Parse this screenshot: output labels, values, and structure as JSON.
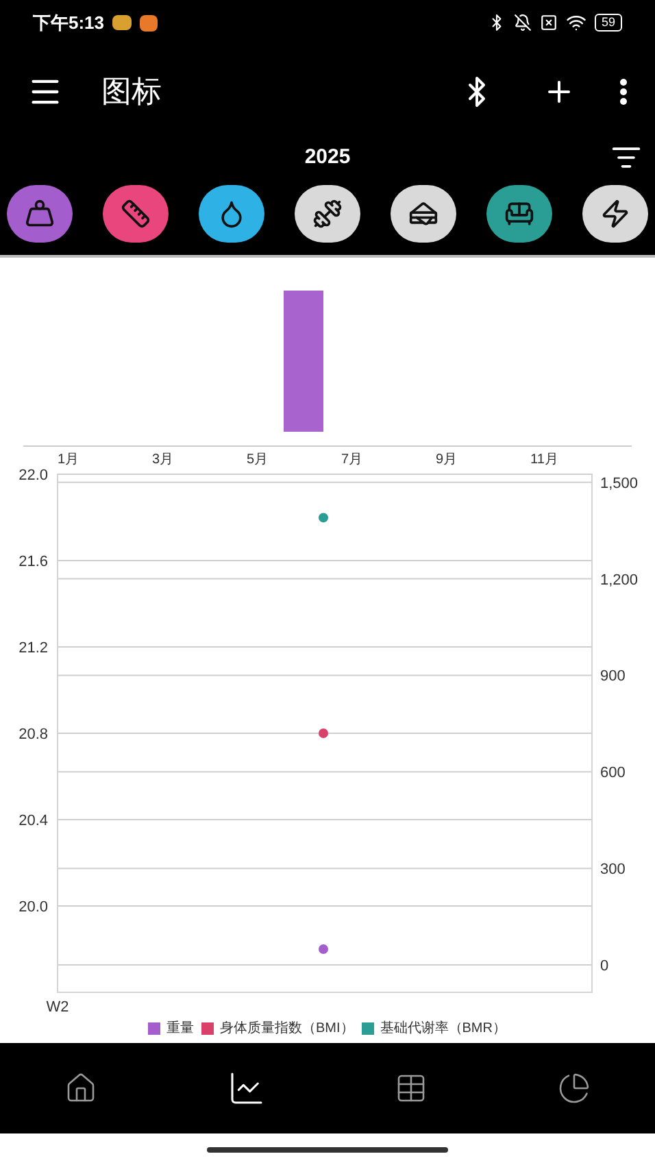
{
  "status_bar": {
    "time": "下午5:13",
    "battery": "59"
  },
  "app_bar": {
    "title": "图标"
  },
  "year_row": {
    "year": "2025"
  },
  "metric_icons": [
    {
      "kind": "weight",
      "color": "#a35dcc"
    },
    {
      "kind": "tape",
      "color": "#e8467c"
    },
    {
      "kind": "drop",
      "color": "#2eb2e5"
    },
    {
      "kind": "dumbbell",
      "color": "#d9d9d9"
    },
    {
      "kind": "burger",
      "color": "#d9d9d9"
    },
    {
      "kind": "sofa",
      "color": "#2a9d94"
    },
    {
      "kind": "energy",
      "color": "#d9d9d9"
    }
  ],
  "monthly_chart": {
    "month_labels": [
      "1月",
      "3月",
      "5月",
      "7月",
      "9月",
      "11月"
    ]
  },
  "trend_chart": {
    "period_label": "W2",
    "chart_data": {
      "type": "scatter",
      "series": [
        {
          "name": "重量",
          "color": "#a35dcc",
          "values": [
            19.8
          ]
        },
        {
          "name": "身体质量指数（BMI）",
          "color": "#d9416b",
          "values": [
            20.8
          ]
        }
      ],
      "grid": true,
      "ylim": [
        19.6,
        22.0
      ],
      "yticks": [
        {
          "value": 20.0,
          "label": "20.0"
        },
        {
          "value": 20.4,
          "label": "20.4"
        },
        {
          "value": 20.8,
          "label": "20.8"
        },
        {
          "value": 21.2,
          "label": "21.2"
        },
        {
          "value": 21.6,
          "label": "21.6"
        },
        {
          "value": 22.0,
          "label": "22.0"
        }
      ]
    }
  },
  "bmr_axis_chart": {
    "chart_data": {
      "type": "scatter",
      "series": [
        {
          "name": "基础代谢率（BMR）",
          "color": "#2a9d94",
          "values": [
            1390
          ]
        }
      ],
      "grid": true,
      "ylim": [
        -85,
        1525
      ],
      "yticks": [
        0,
        300,
        600,
        900,
        {
          "value": 1200,
          "label": "1,200"
        },
        {
          "value": 1500,
          "label": "1,500"
        }
      ]
    }
  },
  "bottom_nav": [
    {
      "kind": "home",
      "selected": false
    },
    {
      "kind": "chart",
      "selected": true
    },
    {
      "kind": "table",
      "selected": false
    },
    {
      "kind": "pie",
      "selected": false
    }
  ]
}
